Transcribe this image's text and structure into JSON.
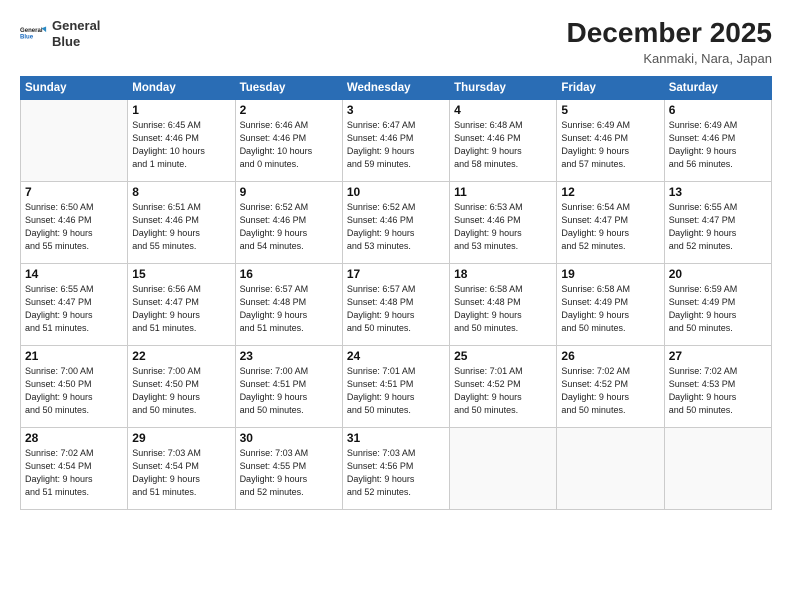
{
  "logo": {
    "line1": "General",
    "line2": "Blue"
  },
  "title": "December 2025",
  "location": "Kanmaki, Nara, Japan",
  "weekdays": [
    "Sunday",
    "Monday",
    "Tuesday",
    "Wednesday",
    "Thursday",
    "Friday",
    "Saturday"
  ],
  "weeks": [
    [
      {
        "day": "",
        "info": ""
      },
      {
        "day": "1",
        "info": "Sunrise: 6:45 AM\nSunset: 4:46 PM\nDaylight: 10 hours\nand 1 minute."
      },
      {
        "day": "2",
        "info": "Sunrise: 6:46 AM\nSunset: 4:46 PM\nDaylight: 10 hours\nand 0 minutes."
      },
      {
        "day": "3",
        "info": "Sunrise: 6:47 AM\nSunset: 4:46 PM\nDaylight: 9 hours\nand 59 minutes."
      },
      {
        "day": "4",
        "info": "Sunrise: 6:48 AM\nSunset: 4:46 PM\nDaylight: 9 hours\nand 58 minutes."
      },
      {
        "day": "5",
        "info": "Sunrise: 6:49 AM\nSunset: 4:46 PM\nDaylight: 9 hours\nand 57 minutes."
      },
      {
        "day": "6",
        "info": "Sunrise: 6:49 AM\nSunset: 4:46 PM\nDaylight: 9 hours\nand 56 minutes."
      }
    ],
    [
      {
        "day": "7",
        "info": "Sunrise: 6:50 AM\nSunset: 4:46 PM\nDaylight: 9 hours\nand 55 minutes."
      },
      {
        "day": "8",
        "info": "Sunrise: 6:51 AM\nSunset: 4:46 PM\nDaylight: 9 hours\nand 55 minutes."
      },
      {
        "day": "9",
        "info": "Sunrise: 6:52 AM\nSunset: 4:46 PM\nDaylight: 9 hours\nand 54 minutes."
      },
      {
        "day": "10",
        "info": "Sunrise: 6:52 AM\nSunset: 4:46 PM\nDaylight: 9 hours\nand 53 minutes."
      },
      {
        "day": "11",
        "info": "Sunrise: 6:53 AM\nSunset: 4:46 PM\nDaylight: 9 hours\nand 53 minutes."
      },
      {
        "day": "12",
        "info": "Sunrise: 6:54 AM\nSunset: 4:47 PM\nDaylight: 9 hours\nand 52 minutes."
      },
      {
        "day": "13",
        "info": "Sunrise: 6:55 AM\nSunset: 4:47 PM\nDaylight: 9 hours\nand 52 minutes."
      }
    ],
    [
      {
        "day": "14",
        "info": "Sunrise: 6:55 AM\nSunset: 4:47 PM\nDaylight: 9 hours\nand 51 minutes."
      },
      {
        "day": "15",
        "info": "Sunrise: 6:56 AM\nSunset: 4:47 PM\nDaylight: 9 hours\nand 51 minutes."
      },
      {
        "day": "16",
        "info": "Sunrise: 6:57 AM\nSunset: 4:48 PM\nDaylight: 9 hours\nand 51 minutes."
      },
      {
        "day": "17",
        "info": "Sunrise: 6:57 AM\nSunset: 4:48 PM\nDaylight: 9 hours\nand 50 minutes."
      },
      {
        "day": "18",
        "info": "Sunrise: 6:58 AM\nSunset: 4:48 PM\nDaylight: 9 hours\nand 50 minutes."
      },
      {
        "day": "19",
        "info": "Sunrise: 6:58 AM\nSunset: 4:49 PM\nDaylight: 9 hours\nand 50 minutes."
      },
      {
        "day": "20",
        "info": "Sunrise: 6:59 AM\nSunset: 4:49 PM\nDaylight: 9 hours\nand 50 minutes."
      }
    ],
    [
      {
        "day": "21",
        "info": "Sunrise: 7:00 AM\nSunset: 4:50 PM\nDaylight: 9 hours\nand 50 minutes."
      },
      {
        "day": "22",
        "info": "Sunrise: 7:00 AM\nSunset: 4:50 PM\nDaylight: 9 hours\nand 50 minutes."
      },
      {
        "day": "23",
        "info": "Sunrise: 7:00 AM\nSunset: 4:51 PM\nDaylight: 9 hours\nand 50 minutes."
      },
      {
        "day": "24",
        "info": "Sunrise: 7:01 AM\nSunset: 4:51 PM\nDaylight: 9 hours\nand 50 minutes."
      },
      {
        "day": "25",
        "info": "Sunrise: 7:01 AM\nSunset: 4:52 PM\nDaylight: 9 hours\nand 50 minutes."
      },
      {
        "day": "26",
        "info": "Sunrise: 7:02 AM\nSunset: 4:52 PM\nDaylight: 9 hours\nand 50 minutes."
      },
      {
        "day": "27",
        "info": "Sunrise: 7:02 AM\nSunset: 4:53 PM\nDaylight: 9 hours\nand 50 minutes."
      }
    ],
    [
      {
        "day": "28",
        "info": "Sunrise: 7:02 AM\nSunset: 4:54 PM\nDaylight: 9 hours\nand 51 minutes."
      },
      {
        "day": "29",
        "info": "Sunrise: 7:03 AM\nSunset: 4:54 PM\nDaylight: 9 hours\nand 51 minutes."
      },
      {
        "day": "30",
        "info": "Sunrise: 7:03 AM\nSunset: 4:55 PM\nDaylight: 9 hours\nand 52 minutes."
      },
      {
        "day": "31",
        "info": "Sunrise: 7:03 AM\nSunset: 4:56 PM\nDaylight: 9 hours\nand 52 minutes."
      },
      {
        "day": "",
        "info": ""
      },
      {
        "day": "",
        "info": ""
      },
      {
        "day": "",
        "info": ""
      }
    ]
  ]
}
